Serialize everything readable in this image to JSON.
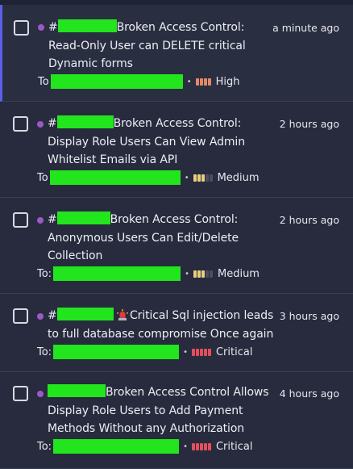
{
  "reports": [
    {
      "prefix": "#",
      "title_after": "Broken Access Control:",
      "title_line2": "Read-Only User can DELETE critical",
      "title_line3": "Dynamic forms",
      "time": "a minute ago",
      "to_label": "To",
      "severity": "High",
      "severity_level": 3
    },
    {
      "prefix": "#",
      "title_after": "Broken Access Control:",
      "title_line2": "Display Role Users Can View Admin",
      "title_line3": "Whitelist Emails via API",
      "time": "2 hours ago",
      "to_label": "To",
      "severity": "Medium",
      "severity_level": 2
    },
    {
      "prefix": "#",
      "title_after": "Broken Access Control:",
      "title_line2": "Anonymous Users Can Edit/Delete",
      "title_line3": "Collection",
      "time": "2 hours ago",
      "to_label": "To:",
      "severity": "Medium",
      "severity_level": 2
    },
    {
      "prefix": "#",
      "title_after": "Critical Sql injection leads",
      "title_line2": "to full database compromise Once again",
      "time": "3 hours ago",
      "to_label": "To:",
      "severity": "Critical",
      "severity_level": 4
    },
    {
      "prefix": "",
      "title_after": "Broken Access Control Allows",
      "title_line2": "Display Role Users to Add Payment",
      "title_line3": "Methods Without any Authorization",
      "time": "4 hours ago",
      "to_label": "To:",
      "severity": "Critical",
      "severity_level": 4
    }
  ],
  "colors": {
    "background": "#1f2334",
    "item_bg": "#272b3d",
    "selected_accent": "#5b5fe6",
    "dot": "#9b59c9",
    "redaction": "#22e51d",
    "critical": "#e3505c",
    "high": "#e38a65",
    "medium": "#e8cf7a"
  },
  "icons": {
    "status_dot": "purple-dot-icon",
    "severity": "severity-bars-icon",
    "alarm": "siren-icon"
  }
}
